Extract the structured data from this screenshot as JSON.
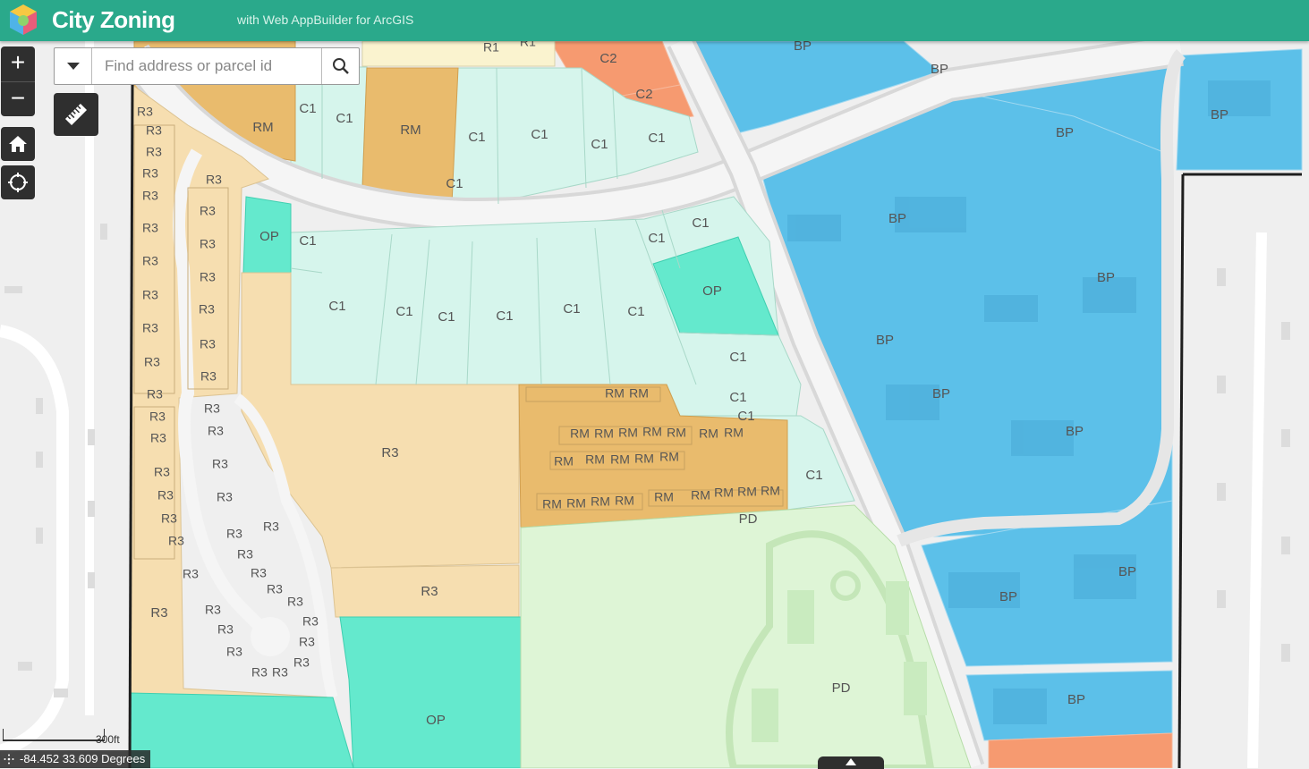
{
  "header": {
    "title": "City Zoning",
    "subtitle": "with Web AppBuilder for ArcGIS"
  },
  "search": {
    "placeholder": "Find address or parcel id"
  },
  "controls": {
    "zoom_in": "+",
    "zoom_out": "−"
  },
  "scalebar": {
    "label": "300ft"
  },
  "coordinates": {
    "text": "-84.452 33.609 Degrees"
  },
  "colors": {
    "header": "#2aa98b",
    "R3": "#f6deb0",
    "RM": "#e9bb6d",
    "C1": "#d6f5ec",
    "C2": "#f69a70",
    "OP": "#64e9cd",
    "BP": "#5cc0e9",
    "PD": "#def5d6"
  },
  "zones": {
    "R1a": "R1",
    "R1b": "R1",
    "C2a": "C2",
    "C2b": "C2",
    "RMa": "RM",
    "RMb": "RM",
    "OPa": "OP",
    "OPb": "OP",
    "OPc": "OP",
    "PDa": "PD",
    "PDb": "PD",
    "R3big": "R3",
    "R3mid": "R3",
    "R3low": "R3",
    "C1": "C1",
    "BP": "BP",
    "R3": "R3",
    "RM": "RM"
  }
}
